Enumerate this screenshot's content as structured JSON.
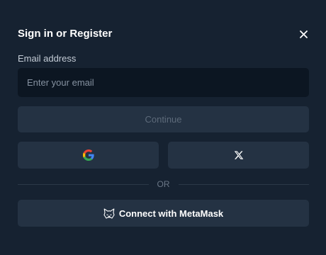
{
  "dialog": {
    "title": "Sign in or Register"
  },
  "email": {
    "label": "Email address",
    "placeholder": "Enter your email",
    "value": ""
  },
  "continue_label": "Continue",
  "divider_label": "OR",
  "metamask_label": "Connect with MetaMask",
  "icons": {
    "close": "close-icon",
    "google": "google-icon",
    "x": "x-logo-icon",
    "metamask": "metamask-fox-icon"
  },
  "colors": {
    "background": "#162231",
    "input_background": "#0c1622",
    "button_background": "#243243",
    "disabled_text": "#5d6a7a",
    "text": "#ffffff"
  }
}
